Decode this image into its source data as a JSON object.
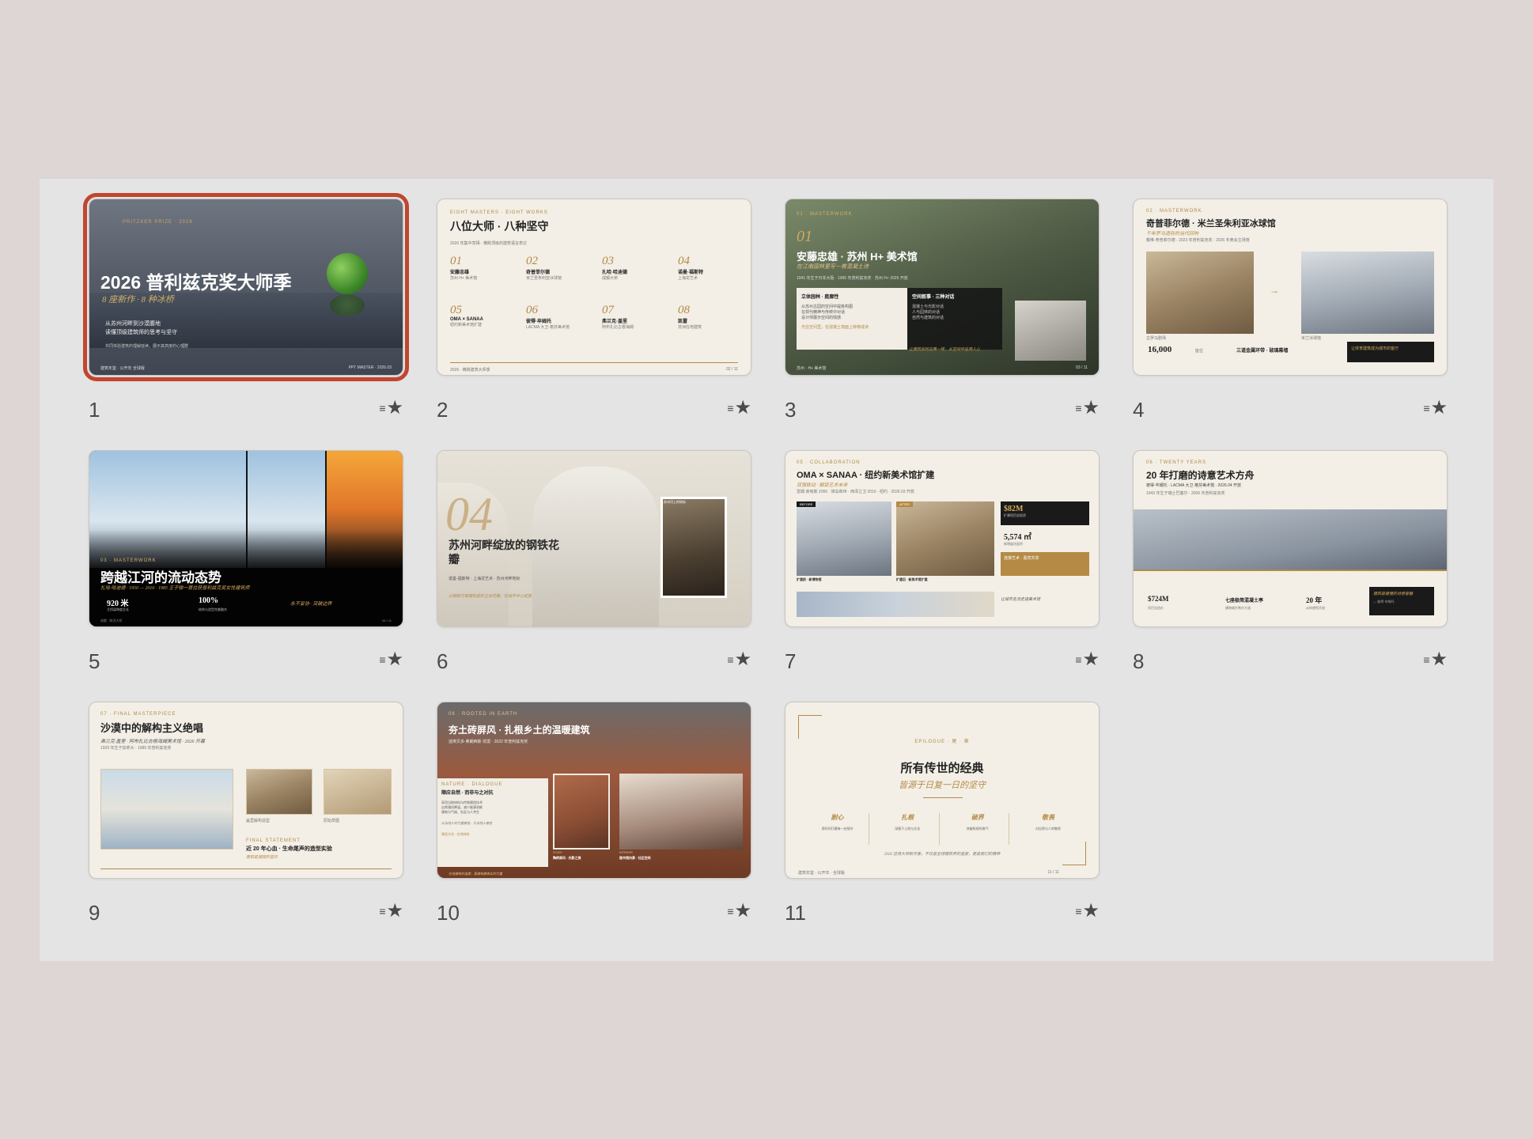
{
  "slides": [
    {
      "number": "1",
      "eyebrow": "PRITZKER PRIZE · 2026",
      "title": "2026 普利兹克奖大师季",
      "subtitle": "8 座新作 · 8 种冰桥",
      "lines": [
        "从苏州河畔到沙漠腹地",
        "读懂顶级建筑师的思考与坚守"
      ],
      "note": "共同体验建筑的理解延续，展示其高度的心理群",
      "footer_left": "建筑年鉴 · 公开年 全球版",
      "footer_right": "PPT MASTER · 2026.03"
    },
    {
      "number": "2",
      "eyebrow": "EIGHT MASTERS · EIGHT WORKS",
      "title": "八位大师 · 八种坚守",
      "subtitle": "2026 年集中亮相 · 横跨顶级的建筑语言表达",
      "items": [
        {
          "n": "01",
          "name": "安藤忠雄",
          "sub": "苏州 H+ 美术馆"
        },
        {
          "n": "02",
          "name": "奇普菲尔德",
          "sub": "米兰圣朱利亚冰球馆"
        },
        {
          "n": "03",
          "name": "扎哈·哈迪德",
          "sub": "成都大桥"
        },
        {
          "n": "04",
          "name": "诺曼·福斯特",
          "sub": "上海龙艺术"
        },
        {
          "n": "05",
          "name": "OMA × SANAA",
          "sub": "纽约新美术馆扩建"
        },
        {
          "n": "06",
          "name": "彼得·卒姆托",
          "sub": "LACMA 大卫·格芬美术馆"
        },
        {
          "n": "07",
          "name": "弗兰克·盖里",
          "sub": "阿布扎比古根海姆"
        },
        {
          "n": "08",
          "name": "凯雷",
          "sub": "非洲在地建筑"
        }
      ],
      "footer_left": "2026 · 横跨建筑大师季",
      "footer_right": "02 / 11"
    },
    {
      "number": "3",
      "eyebrow": "01 · MASTERWORK",
      "num_large": "01",
      "title": "安藤忠雄 · 苏州 H+ 美术馆",
      "subtitle": "在江南园林里写一首混凝土诗",
      "meta": "1941 年生于日本大阪 · 1995 年普利兹克奖 · 苏州 H+ 2026 开放",
      "col1_title": "立体园林 · 庭廊性",
      "col1_lines": [
        "从苏州古园的空间中提炼构图",
        "在现代精神与传统中对话",
        "设计师展示空间的情感"
      ],
      "col1_note": "光在空间里，在混凝土墙面上转移成诗",
      "col2_title": "空间叙事 · 三种对话",
      "col2_lines": [
        "混凝土与光影对话",
        "人与园林的对话",
        "自然与建筑的对话"
      ],
      "quote": "让建筑如同古典一样，从空间中追溯人心",
      "footer_left": "苏州 · H+ 美术馆",
      "footer_right": "03 / 11"
    },
    {
      "number": "4",
      "eyebrow": "02 · MASTERWORK",
      "title": "奇普菲尔德 · 米兰圣朱利亚冰球馆",
      "subtitle": "千年罗马遗存的当代回响",
      "meta": "戴维·奇普菲尔德 · 2023 年普利兹克奖 · 2026 冬奥会主场馆",
      "stat1": "16,000",
      "stat1_label": "座位",
      "stat2": "三道金属环带 · 玻璃幕墙",
      "note_box": "让体育建筑成为城市的客厅",
      "caption1": "古罗马剧场",
      "caption2": "米兰冰球馆"
    },
    {
      "number": "5",
      "eyebrow": "03 · MASTERWORK",
      "title": "跨越江河的流动态势",
      "subtitle": "扎哈·哈迪德 · 1950 — 2016 · 1985 王子咖一首位获普利兹克奖女性建筑师",
      "stat1": "920 米",
      "stat1_label": "主桥梁跨度总长",
      "stat2": "100%",
      "stat2_label": "结构与造型完美融合",
      "quote": "永不妥协 · 突破边界",
      "footer_left": "成都 · 跨河大桥",
      "footer_right": "05 / 11"
    },
    {
      "number": "6",
      "num_large": "04",
      "title": "苏州河畔绽放的钢铁花瓣",
      "subtitle": "诺曼·福斯特 · 上海龙艺术 · 苏州河畔地标",
      "note": "以钢铁与玻璃构成的立体花瓣，在城市中心绽放",
      "tag": "苏州河上的地标"
    },
    {
      "number": "7",
      "eyebrow": "05 · COLLABORATION",
      "title": "OMA × SANAA · 纽约新美术馆扩建",
      "subtitle": "双强联动 · 解锁艺术未来",
      "meta": "雷姆·库哈斯 2000 · 妹岛和世 · 西泽立卫 2010 · 纽约 · 2026.03 开放",
      "tag_before": "BEFORE",
      "tag_after": "AFTER",
      "stat1": "$82M",
      "stat1_label": "扩建项目总投资",
      "stat2": "5,574 ㎡",
      "stat2_label": "新增展览面积",
      "stat3": "连接艺术 · 嘉宾共享",
      "caption1": "扩建前 · 新博物馆",
      "caption2": "扩建后 · 新美术馆扩建",
      "side_note": "让城市生活走进美术馆"
    },
    {
      "number": "8",
      "eyebrow": "06 · TWENTY YEARS",
      "title": "20 年打磨的诗意艺术方舟",
      "subtitle": "彼得·卒姆托 · LACMA 大卫·格芬美术馆 · 2026.04 开放",
      "meta": "1943 年生于瑞士巴塞尔 · 2009 年普利兹克奖",
      "stat1": "$724M",
      "stat1_label": "项目总造价",
      "stat2": "七座极简混凝土亭",
      "stat2_label": "横跨威尔希尔大道",
      "stat3": "20 年",
      "stat3_label": "从构想到开放",
      "quote": "建筑是缓慢的诗意容器",
      "quote_by": "— 彼得·卒姆托"
    },
    {
      "number": "9",
      "eyebrow": "07 · FINAL MASTERPIECE",
      "title": "沙漠中的解构主义绝唱",
      "subtitle": "弗兰克·盖里 · 阿布扎比古根海姆美术馆 · 2026 开幕",
      "meta": "1929 年生于加拿大 · 1989 年普利兹克奖",
      "caption1": "盖里解构造型",
      "caption2": "原始草图",
      "tag": "FINAL STATEMENT",
      "headline": "近 20 年心血 · 生命尾声的造型实验",
      "headline_sub": "建筑是凝固的音乐"
    },
    {
      "number": "10",
      "eyebrow": "08 · ROOTED IN EARTH",
      "title": "夯土砖屏风 · 扎根乡土的温暖建筑",
      "subtitle": "迪埃贝多·弗朗西斯·凯雷 · 2022 年普利兹克奖",
      "box_tag": "NATURE · DIALOGUE",
      "box_title": "顺应自然 · 而非与之对抗",
      "box_lines": [
        "采用当地材料与传统建造技术",
        "自然通风降温，减少能源消耗",
        "建筑与气候、社区与人共生"
      ],
      "box_quote": "以当地人的力量建造，为当地人建造",
      "box_link": "建造方式 · 在地材料",
      "tag1": "STUDY",
      "cap1": "陶砖屏风 · 光影之美",
      "tag2": "INTERIOR",
      "cap2": "图书馆内景 · 社区空间",
      "footer": "在地建筑的温度，是建筑最真实的力量"
    },
    {
      "number": "11",
      "eyebrow": "EPILOGUE · 尾 · 章",
      "title": "所有传世的经典",
      "subtitle": "皆源于日复一日的坚守",
      "cols": [
        {
          "t": "耐心",
          "d": "用时间打磨每一处细节"
        },
        {
          "t": "扎根",
          "d": "深植于土地与文化"
        },
        {
          "t": "破界",
          "d": "突破陈规的勇气"
        },
        {
          "t": "敬畏",
          "d": "对自然与人的敬畏"
        }
      ],
      "quote": "2026 这场大师新作季，不仅是全球建筑界的盛宴，更是我们的精神",
      "footer_left": "建筑年鉴 · 公开年 · 全球版",
      "footer_right": "11 / 11"
    }
  ]
}
